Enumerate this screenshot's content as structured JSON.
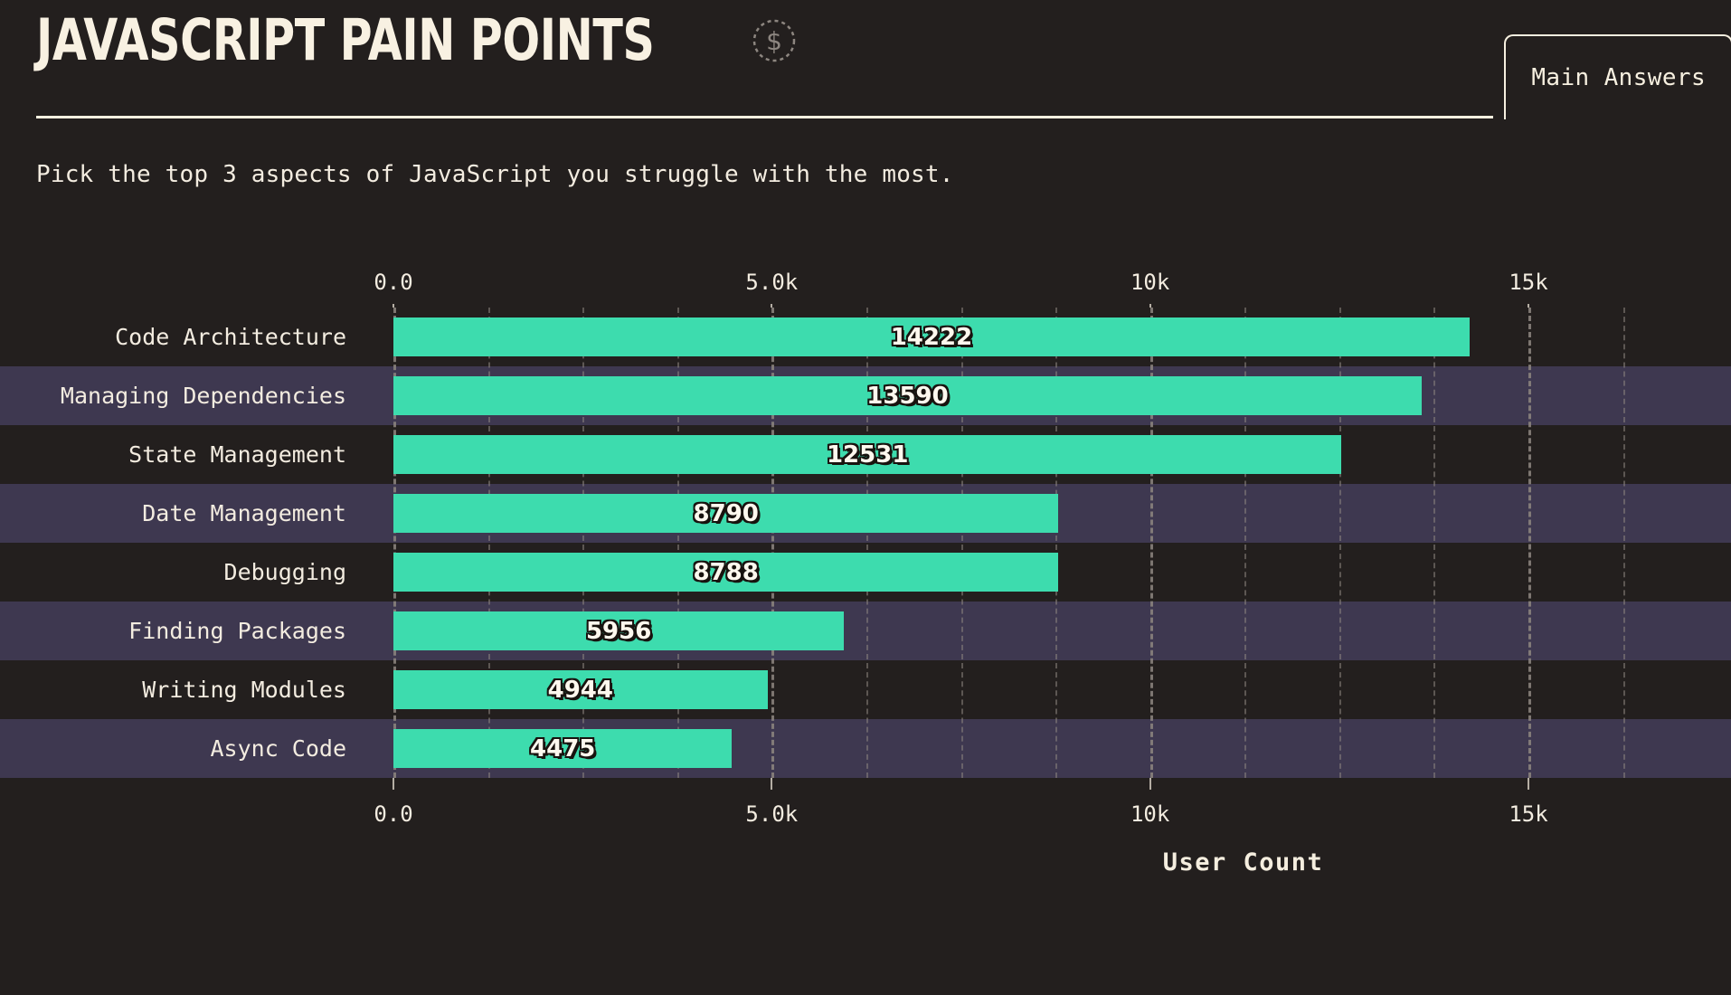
{
  "header": {
    "title": "JAVASCRIPT PAIN POINTS",
    "icon": "dollar-circle-dashed-icon",
    "tab_label": "Main Answers"
  },
  "subtitle": "Pick the top 3 aspects of JavaScript you struggle with the most.",
  "colors": {
    "background": "#231f1e",
    "bar": "#3ddcae",
    "text": "#f5eedf",
    "stripe": "#3e3850",
    "grid": "#8d8680"
  },
  "chart_data": {
    "type": "bar",
    "orientation": "horizontal",
    "title": "JAVASCRIPT PAIN POINTS",
    "subtitle": "Pick the top 3 aspects of JavaScript you struggle with the most.",
    "xlabel": "User Count",
    "ylabel": "",
    "categories": [
      "Code Architecture",
      "Managing Dependencies",
      "State Management",
      "Date Management",
      "Debugging",
      "Finding Packages",
      "Writing Modules",
      "Async Code"
    ],
    "values": [
      14222,
      13590,
      12531,
      8790,
      8788,
      5956,
      4944,
      4475
    ],
    "value_labels": [
      "14222",
      "13590",
      "12531",
      "8790",
      "8788",
      "5956",
      "4944",
      "4475"
    ],
    "xlim": [
      0,
      17650
    ],
    "x_major_ticks": [
      0,
      5000,
      10000,
      15000
    ],
    "x_major_tick_labels": [
      "0.0",
      "5.0k",
      "10k",
      "15k"
    ],
    "x_minor_ticks": [
      1250,
      2500,
      3750,
      6250,
      7500,
      8750,
      11250,
      12500,
      13750,
      16250
    ],
    "grid": true,
    "legend": false,
    "bar_color": "#3ddcae",
    "row_stripes": true,
    "axis_duplicated_top_and_bottom": true
  }
}
